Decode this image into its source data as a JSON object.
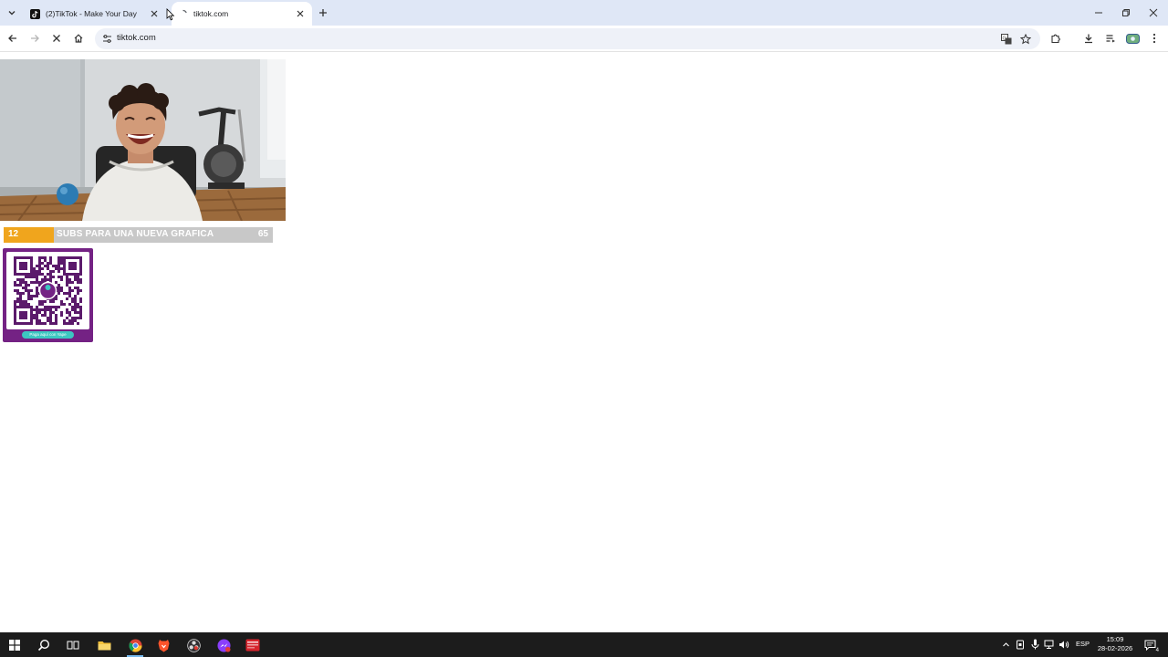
{
  "browser": {
    "tabs": [
      {
        "title": "(2)TikTok - Make Your Day",
        "active": false
      },
      {
        "title": "tiktok.com",
        "active": true
      }
    ],
    "url": "tiktok.com"
  },
  "overlay": {
    "subs_current": "12",
    "subs_label": "SUBS PARA UNA NUEVA GRAFICA",
    "subs_goal": "65",
    "subs_progress": 0.185,
    "qr_caption": "Paga aquí con Yape"
  },
  "taskbar": {
    "language": "ESP",
    "time": "15:09",
    "date": "28-02-2026",
    "notification_count": "4",
    "pinned": [
      "start-button",
      "search",
      "task-view",
      "file-explorer",
      "chrome",
      "brave",
      "obs-studio",
      "app-messenger",
      "app-red"
    ]
  },
  "colors": {
    "tabstrip": "#dfe7f6",
    "accent_orange": "#f0a51d",
    "yape_purple": "#742284",
    "yape_teal": "#3cc7c1",
    "taskbar": "#1c1c1c"
  }
}
